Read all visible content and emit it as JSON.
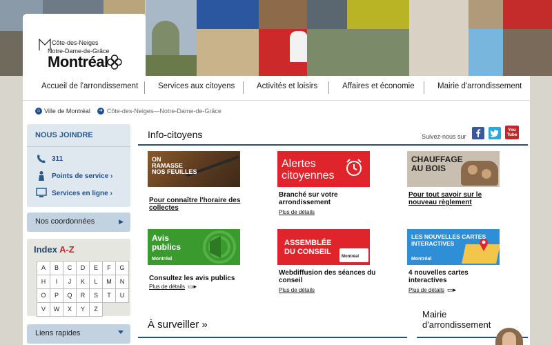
{
  "logo": {
    "line1": "Côte-des-Neiges",
    "line2": "Notre-Dame-de-Grâce",
    "line3": "Montréal"
  },
  "nav": {
    "items": [
      {
        "label": "Accueil de l'arrondissement"
      },
      {
        "label": "Services aux citoyens"
      },
      {
        "label": "Activités et loisirs"
      },
      {
        "label": "Affaires et économie"
      },
      {
        "label": "Mairie d'arrondissement"
      }
    ]
  },
  "breadcrumb": {
    "home": "Ville de Montréal",
    "current": "Côte-des-Neiges—Notre-Dame-de-Grâce"
  },
  "sidebar": {
    "join_title": "NOUS JOINDRE",
    "phone": "311",
    "service_points": "Points de service",
    "online_services": "Services en ligne",
    "coordinates": "Nos coordonnées",
    "az_title_prefix": "Index ",
    "az_title_accent": "A-Z",
    "letters": [
      "A",
      "B",
      "C",
      "D",
      "E",
      "F",
      "G",
      "H",
      "I",
      "J",
      "K",
      "L",
      "M",
      "N",
      "O",
      "P",
      "Q",
      "R",
      "S",
      "T",
      "U",
      "V",
      "W",
      "X",
      "Y",
      "Z"
    ],
    "quick_links": "Liens rapides"
  },
  "main": {
    "info_title": "Info-citoyens",
    "follow_us": "Suivez-nous sur",
    "more": "Plus de détails",
    "cards": [
      {
        "img_text": "ON\nRAMASSE\nNOS FEUILLES",
        "title": "Pour connaître l'horaire des collectes"
      },
      {
        "img_text": "Alertes\ncitoyennes",
        "title": "Branché sur votre arrondissement"
      },
      {
        "img_text": "CHAUFFAGE\nAU BOIS",
        "title": "Pour tout savoir sur le nouveau règlement"
      },
      {
        "img_text": "Avis\npublics",
        "title": "Consultez les avis publics"
      },
      {
        "img_text": "ASSEMBLÉE\nDU CONSEIL",
        "title": "Webdiffusion des séances du conseil"
      },
      {
        "img_text": "LES NOUVELLES CARTES\nINTERACTIVES",
        "title": "4 nouvelles cartes interactives"
      }
    ],
    "watch_title": "À surveiller  »",
    "mayor_title": "Mairie\nd'arrondissement",
    "social": [
      "Facebook",
      "Twitter",
      "YouTube"
    ],
    "youtube_text": "You Tube"
  },
  "colors": {
    "brand_blue": "#1f4f8f",
    "alert_red": "#e0242b",
    "green": "#3a9a2e",
    "light_blue": "#2f8fd6"
  }
}
